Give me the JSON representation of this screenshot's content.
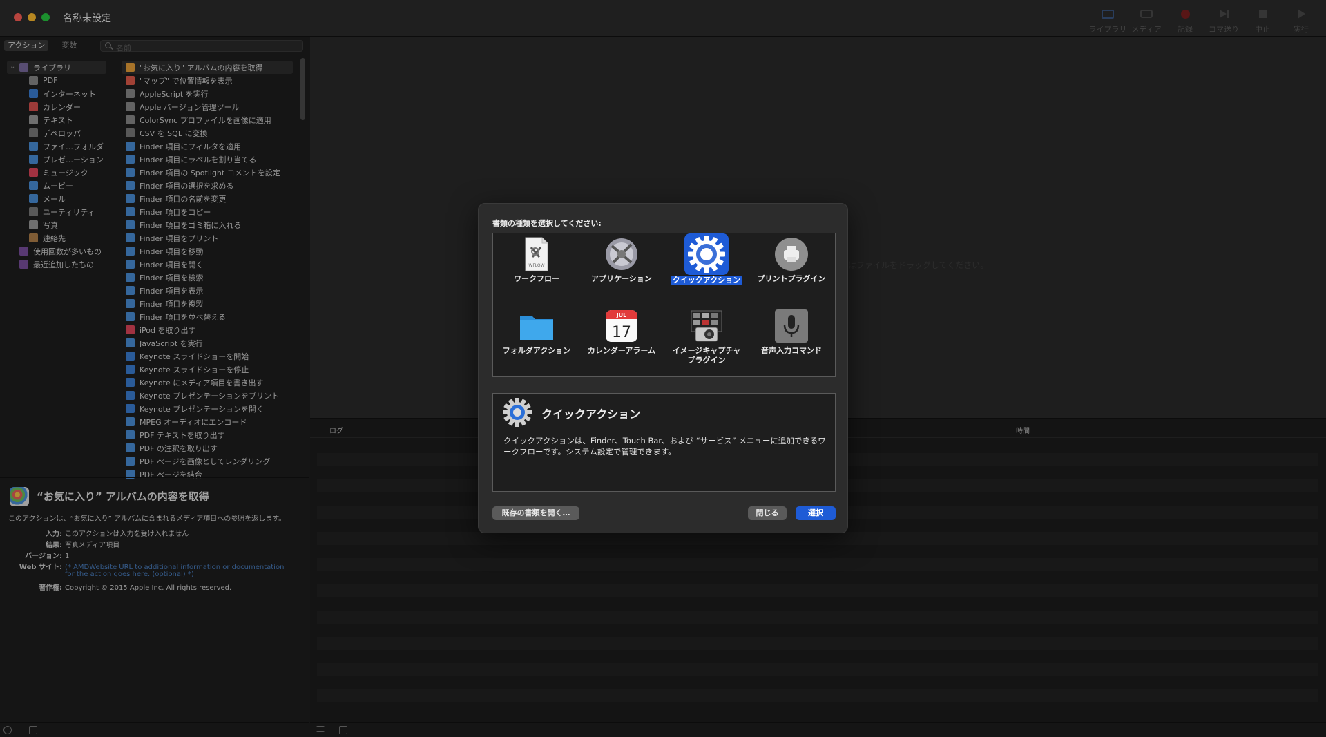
{
  "window": {
    "title": "名称未設定"
  },
  "toolbar": [
    {
      "label": "ライブラリ",
      "icon": "library-icon"
    },
    {
      "label": "メディア",
      "icon": "media-icon"
    },
    {
      "label": "記録",
      "icon": "record-icon"
    },
    {
      "label": "コマ送り",
      "icon": "step-icon"
    },
    {
      "label": "中止",
      "icon": "stop-icon"
    },
    {
      "label": "実行",
      "icon": "run-icon"
    }
  ],
  "left": {
    "tabs": [
      "アクション",
      "変数"
    ],
    "search_placeholder": "名前",
    "categories": [
      {
        "label": "ライブラリ",
        "color": "#7a6b9e"
      },
      {
        "label": "PDF",
        "color": "#8a8a8a"
      },
      {
        "label": "インターネット",
        "color": "#3b7fd4"
      },
      {
        "label": "カレンダー",
        "color": "#d9534f"
      },
      {
        "label": "テキスト",
        "color": "#9a9a9a"
      },
      {
        "label": "デベロッパ",
        "color": "#7a7a7a"
      },
      {
        "label": "ファイ…フォルダ",
        "color": "#4a8fd8"
      },
      {
        "label": "プレゼ…ーション",
        "color": "#4a8fd8"
      },
      {
        "label": "ミュージック",
        "color": "#e0465a"
      },
      {
        "label": "ムービー",
        "color": "#4a8fd8"
      },
      {
        "label": "メール",
        "color": "#4a8fd8"
      },
      {
        "label": "ユーティリティ",
        "color": "#7a7a7a"
      },
      {
        "label": "写真",
        "color": "#9a9a9a"
      },
      {
        "label": "連絡先",
        "color": "#b0804a"
      },
      {
        "label": "使用回数が多いもの",
        "color": "#7b4f9e"
      },
      {
        "label": "最近追加したもの",
        "color": "#7b4f9e"
      }
    ],
    "actions": [
      "\"お気に入り\" アルバムの内容を取得",
      "\"マップ\" で位置情報を表示",
      "AppleScript を実行",
      "Apple バージョン管理ツール",
      "ColorSync プロファイルを画像に適用",
      "CSV を SQL に変換",
      "Finder 項目にフィルタを適用",
      "Finder 項目にラベルを割り当てる",
      "Finder 項目の Spotlight コメントを設定",
      "Finder 項目の選択を求める",
      "Finder 項目の名前を変更",
      "Finder 項目をコピー",
      "Finder 項目をゴミ箱に入れる",
      "Finder 項目をプリント",
      "Finder 項目を移動",
      "Finder 項目を開く",
      "Finder 項目を検索",
      "Finder 項目を表示",
      "Finder 項目を複製",
      "Finder 項目を並べ替える",
      "iPod を取り出す",
      "JavaScript を実行",
      "Keynote スライドショーを開始",
      "Keynote スライドショーを停止",
      "Keynote にメディア項目を書き出す",
      "Keynote プレゼンテーションをプリント",
      "Keynote プレゼンテーションを開く",
      "MPEG オーディオにエンコード",
      "PDF テキストを取り出す",
      "PDF の注釈を取り出す",
      "PDF ページを画像としてレンダリング",
      "PDF ページを結合"
    ],
    "description": {
      "title": "“お気に入り” アルバムの内容を取得",
      "text": "このアクションは、“お気に入り” アルバムに含まれるメディア項目への参照を返します。",
      "input_key": "入力:",
      "input_val": "このアクションは入力を受け入れません",
      "result_key": "結果:",
      "result_val": "写真メディア項目",
      "version_key": "バージョン:",
      "version_val": "1",
      "website_key": "Web サイト:",
      "website_val1": "(* AMDWebsite URL to additional information or documentation",
      "website_val2": "for the action goes here. (optional) *)",
      "copyright_key": "著作権:",
      "copyright_val": "Copyright © 2015 Apple Inc. All rights reserved."
    }
  },
  "workflow": {
    "hint": "はファイルをドラッグしてください。"
  },
  "log": {
    "col_log": "ログ",
    "col_time": "時間"
  },
  "dialog": {
    "prompt": "書類の種類を選択してください:",
    "types": [
      {
        "label": "ワークフロー",
        "icon": "workflow-document-icon"
      },
      {
        "label": "アプリケーション",
        "icon": "application-robot-icon"
      },
      {
        "label": "クイックアクション",
        "icon": "gear-icon"
      },
      {
        "label": "プリントプラグイン",
        "icon": "printer-icon"
      },
      {
        "label": "フォルダアクション",
        "icon": "folder-icon"
      },
      {
        "label": "カレンダーアラーム",
        "icon": "calendar-icon"
      },
      {
        "label": "イメージキャプチャ\nプラグイン",
        "icon": "camera-icon"
      },
      {
        "label": "音声入力コマンド",
        "icon": "microphone-icon"
      }
    ],
    "calendar_month": "JUL",
    "calendar_day": "17",
    "selected_index": 2,
    "info_title": "クイックアクション",
    "info_text": "クイックアクションは、Finder、Touch Bar、および “サービス” メニューに追加できるワークフローです。システム設定で管理できます。",
    "open_existing": "既存の書類を開く…",
    "close": "閉じる",
    "choose": "選択",
    "accent": "#1e5bd6"
  }
}
